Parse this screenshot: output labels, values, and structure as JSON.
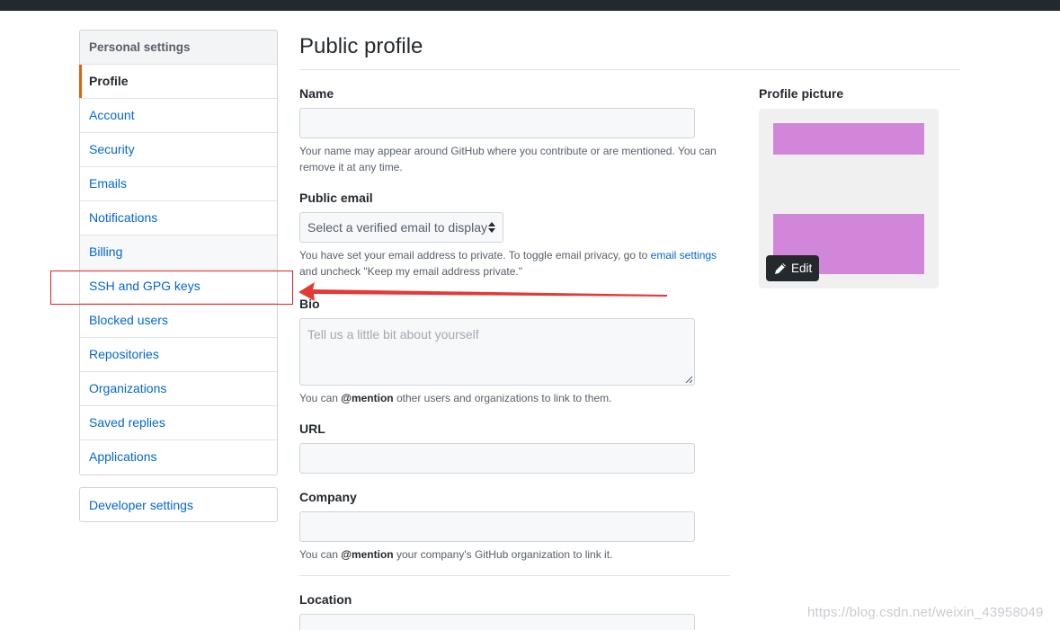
{
  "sidebar": {
    "heading": "Personal settings",
    "items": [
      {
        "label": "Profile"
      },
      {
        "label": "Account"
      },
      {
        "label": "Security"
      },
      {
        "label": "Emails"
      },
      {
        "label": "Notifications"
      },
      {
        "label": "Billing"
      },
      {
        "label": "SSH and GPG keys"
      },
      {
        "label": "Blocked users"
      },
      {
        "label": "Repositories"
      },
      {
        "label": "Organizations"
      },
      {
        "label": "Saved replies"
      },
      {
        "label": "Applications"
      }
    ],
    "developer_settings": "Developer settings"
  },
  "main": {
    "title": "Public profile",
    "name": {
      "label": "Name",
      "value": "",
      "note": "Your name may appear around GitHub where you contribute or are mentioned. You can remove it at any time."
    },
    "public_email": {
      "label": "Public email",
      "selected": "Select a verified email to display",
      "note_before": "You have set your email address to private. To toggle email privacy, go to ",
      "note_link": "email settings",
      "note_after": " and uncheck \"Keep my email address private.\""
    },
    "bio": {
      "label": "Bio",
      "placeholder": "Tell us a little bit about yourself",
      "note_before": "You can ",
      "note_mention": "@mention",
      "note_after": " other users and organizations to link to them."
    },
    "url": {
      "label": "URL",
      "value": ""
    },
    "company": {
      "label": "Company",
      "value": "",
      "note_before": "You can ",
      "note_mention": "@mention",
      "note_after": " your company's GitHub organization to link it."
    },
    "location": {
      "label": "Location",
      "value": ""
    }
  },
  "profile_picture": {
    "label": "Profile picture",
    "edit_label": "Edit"
  },
  "annotation": {
    "color": "#e02424"
  },
  "watermark": "https://blog.csdn.net/weixin_43958049",
  "colors": {
    "accent_selected": "#e36209",
    "link": "#0366d6",
    "avatar_placeholder": "#d286d9"
  }
}
